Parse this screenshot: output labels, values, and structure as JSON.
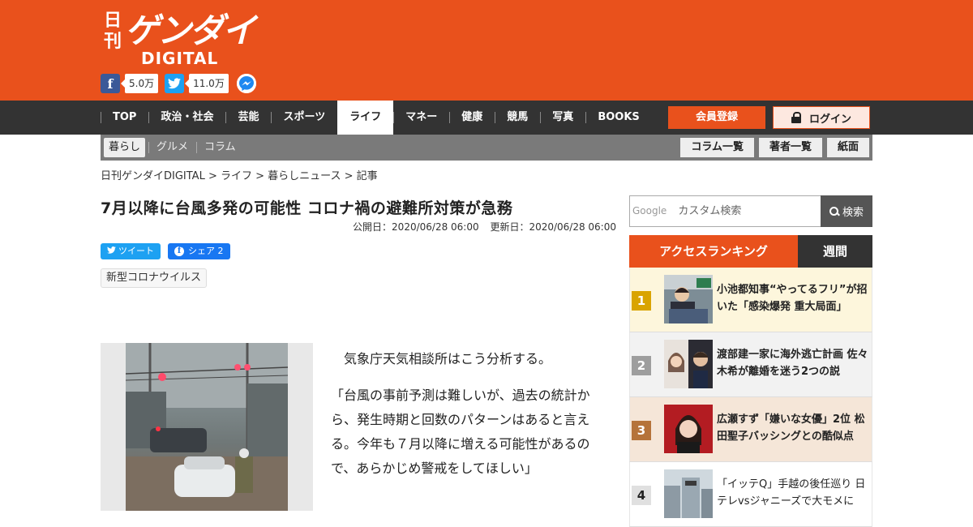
{
  "brand": {
    "nikkan": "日刊",
    "gendai": "ゲンダイ",
    "digital": "DIGITAL",
    "color": "#e9511c"
  },
  "social": {
    "facebook_icon": "facebook-icon",
    "facebook_count": "5.0万",
    "twitter_icon": "twitter-icon",
    "twitter_count": "11.0万",
    "messenger_icon": "messenger-icon"
  },
  "nav": {
    "items": [
      {
        "label": "TOP"
      },
      {
        "label": "政治・社会"
      },
      {
        "label": "芸能"
      },
      {
        "label": "スポーツ"
      },
      {
        "label": "ライフ"
      },
      {
        "label": "マネー"
      },
      {
        "label": "健康"
      },
      {
        "label": "競馬"
      },
      {
        "label": "写真"
      },
      {
        "label": "BOOKS"
      }
    ],
    "active": "ライフ",
    "register_label": "会員登録",
    "login_label": "ログイン"
  },
  "subnav": {
    "items": [
      {
        "label": "暮らし"
      },
      {
        "label": "グルメ"
      },
      {
        "label": "コラム"
      }
    ],
    "active": "暮らし",
    "buttons": [
      {
        "label": "コラム一覧"
      },
      {
        "label": "著者一覧"
      },
      {
        "label": "紙面"
      }
    ]
  },
  "breadcrumb": "日刊ゲンダイDIGITAL > ライフ > 暮らしニュース > 記事",
  "article": {
    "title": "7月以降に台風多発の可能性 コロナ禍の避難所対策が急務",
    "published": "公開日：2020/06/28 06:00",
    "updated": "更新日：2020/06/28 06:00",
    "tweet_label": "ツイート",
    "share_label": "シェア 2",
    "tag": "新型コロナウイルス",
    "paragraphs": [
      "　気象庁天気相談所はこう分析する。",
      "「台風の事前予測は難しいが、過去の統計から、発生時期と回数のパターンはあると言える。今年も７月以降に増える可能性があるので、あらかじめ警戒をしてほしい」"
    ]
  },
  "sidebar": {
    "search_brand": "Google",
    "search_placeholder": "カスタム検索",
    "search_button": "検索",
    "ranking_tab": "アクセスランキング",
    "weekly_tab": "週間",
    "ranking": [
      {
        "rank": "1",
        "title": "小池都知事“やってるフリ”が招いた「感染爆発 重大局面」",
        "color": "#d9a400"
      },
      {
        "rank": "2",
        "title": "渡部建一家に海外逃亡計画 佐々木希が離婚を迷う2つの説",
        "color": "#9e9e9e"
      },
      {
        "rank": "3",
        "title": "広瀬すず「嫌いな女優」2位 松田聖子バッシングとの酷似点",
        "color": "#b5733a"
      },
      {
        "rank": "4",
        "title": "「イッテQ」手越の後任巡り 日テレvsジャニーズで大モメに",
        "color": "#bdbdbd"
      }
    ]
  }
}
